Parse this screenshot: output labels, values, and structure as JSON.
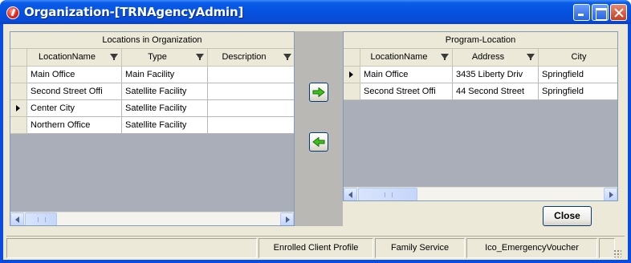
{
  "window": {
    "title": "Organization-[TRNAgencyAdmin]"
  },
  "left_grid": {
    "caption": "Locations in Organization",
    "columns": [
      "LocationName",
      "Type",
      "Description"
    ],
    "rows": [
      {
        "cells": [
          "Main Office",
          "Main Facility",
          ""
        ],
        "current": false
      },
      {
        "cells": [
          "Second Street Offi",
          "Satellite Facility",
          ""
        ],
        "current": false
      },
      {
        "cells": [
          "Center City",
          "Satellite Facility",
          ""
        ],
        "current": true
      },
      {
        "cells": [
          "Northern Office",
          "Satellite Facility",
          ""
        ],
        "current": false
      }
    ]
  },
  "right_grid": {
    "caption": "Program-Location",
    "columns": [
      "LocationName",
      "Address",
      "City"
    ],
    "rows": [
      {
        "cells": [
          "Main Office",
          "3435 Liberty Driv",
          "Springfield"
        ],
        "current": true
      },
      {
        "cells": [
          "Second Street Offi",
          "44 Second Street",
          "Springfield"
        ],
        "current": false
      }
    ]
  },
  "buttons": {
    "close_label": "Close"
  },
  "statusbar": {
    "panels": [
      "",
      "Enrolled Client Profile",
      "Family Service",
      "Ico_EmergencyVoucher",
      ""
    ]
  },
  "colors": {
    "title_bar": "#0553e0",
    "panel_bg": "#ece9d8",
    "arrow_green": "#3cbf1f"
  }
}
